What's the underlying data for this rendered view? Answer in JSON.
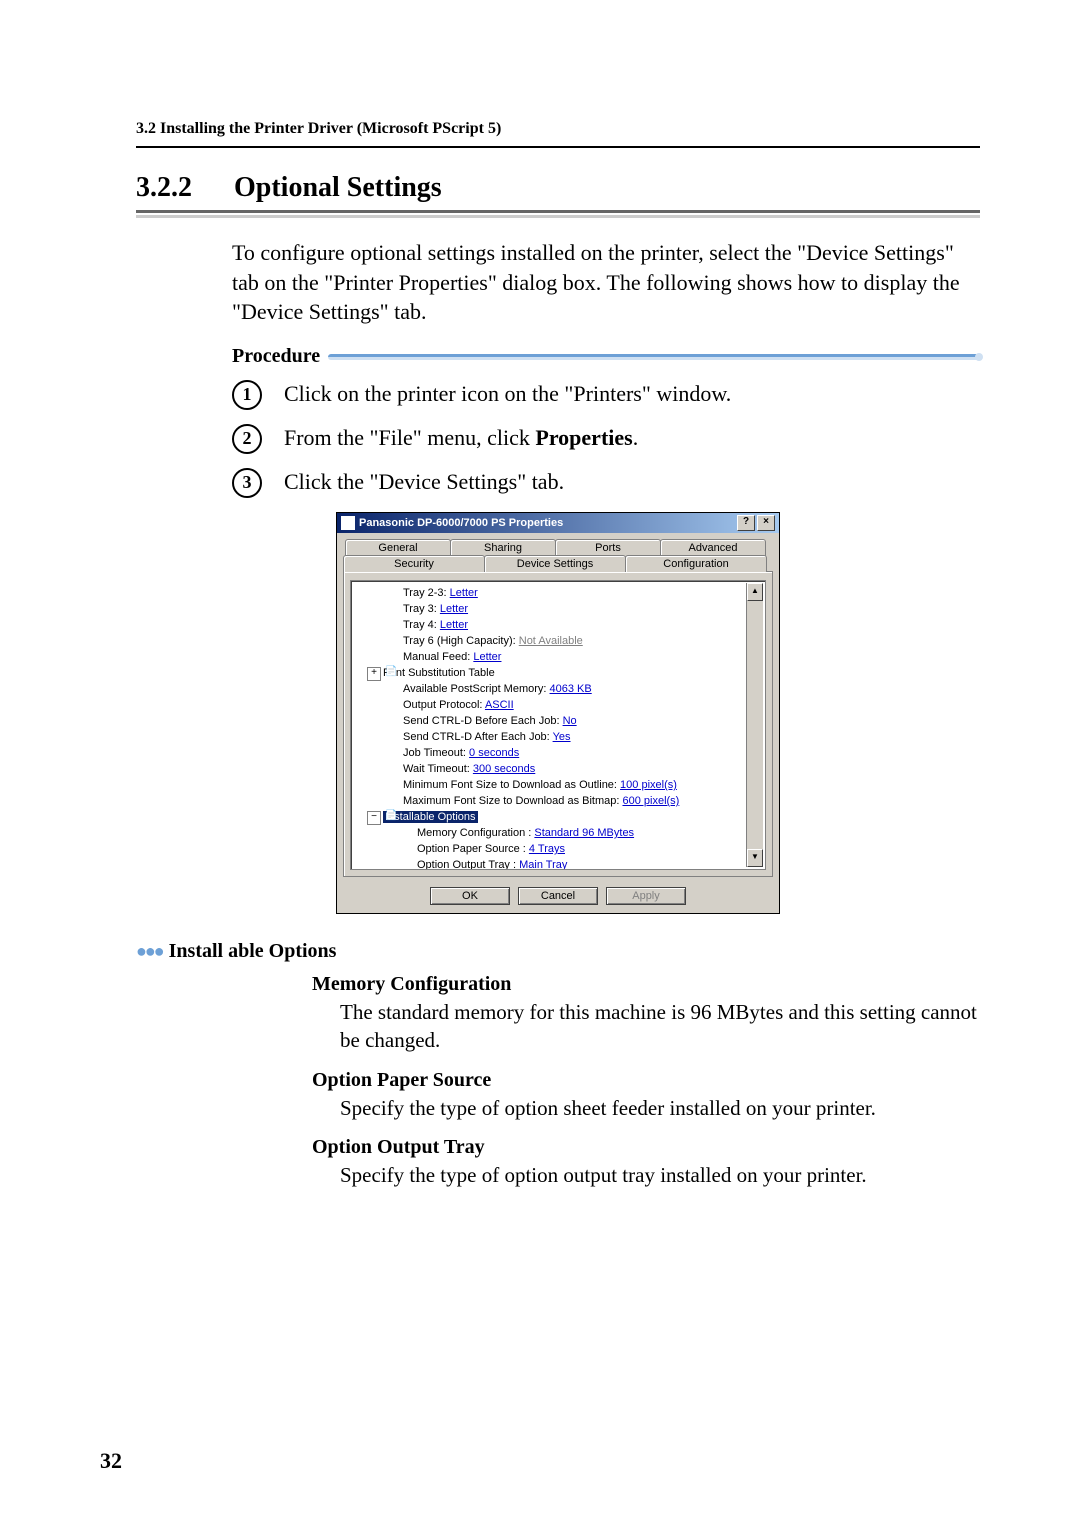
{
  "header": {
    "running": "3.2    Installing the Printer Driver (Microsoft PScript 5)"
  },
  "section": {
    "number": "3.2.2",
    "title": "Optional Settings",
    "intro": "To configure optional settings installed on the printer, select the \"Device Settings\" tab on the \"Printer Properties\" dialog box. The following shows how to display the \"Device Settings\" tab."
  },
  "procedure": {
    "heading": "Procedure",
    "steps": [
      {
        "num": "1",
        "text_pre": "Click on the printer icon on the \"Printers\" window.",
        "bold": "",
        "text_post": ""
      },
      {
        "num": "2",
        "text_pre": "From the \"File\" menu, click ",
        "bold": "Properties",
        "text_post": "."
      },
      {
        "num": "3",
        "text_pre": "Click the  \"Device Settings\" tab.",
        "bold": "",
        "text_post": ""
      }
    ]
  },
  "dialog": {
    "title": "Panasonic DP-6000/7000 PS Properties",
    "help": "?",
    "close": "×",
    "tabs_back": [
      "General",
      "Sharing",
      "Ports",
      "Advanced"
    ],
    "tabs_front": [
      "Security",
      "Device Settings",
      "Configuration"
    ],
    "tree": [
      {
        "lvl": "1",
        "label": "Tray 2-3: ",
        "link": "Letter"
      },
      {
        "lvl": "1",
        "label": "Tray 3: ",
        "link": "Letter"
      },
      {
        "lvl": "1",
        "label": "Tray 4: ",
        "link": "Letter"
      },
      {
        "lvl": "1",
        "label": "Tray 6 (High Capacity): ",
        "gray": "Not Available"
      },
      {
        "lvl": "1",
        "label": "Manual Feed: ",
        "link": "Letter"
      },
      {
        "lvl": "0",
        "icon": "plus",
        "label": "Font Substitution Table"
      },
      {
        "lvl": "0b",
        "label": "Available PostScript Memory: ",
        "link": "4063 KB"
      },
      {
        "lvl": "0b",
        "label": "Output Protocol: ",
        "link": "ASCII"
      },
      {
        "lvl": "0b",
        "label": "Send CTRL-D Before Each Job: ",
        "link": "No"
      },
      {
        "lvl": "0b",
        "label": "Send CTRL-D After Each Job: ",
        "link": "Yes"
      },
      {
        "lvl": "0b",
        "label": "Job Timeout: ",
        "link": "0 seconds"
      },
      {
        "lvl": "0b",
        "label": "Wait Timeout: ",
        "link": "300 seconds"
      },
      {
        "lvl": "0b",
        "label": "Minimum Font Size to Download as Outline: ",
        "link": "100 pixel(s)"
      },
      {
        "lvl": "0b",
        "label": "Maximum Font Size to Download as Bitmap: ",
        "link": "600 pixel(s)"
      },
      {
        "lvl": "0",
        "icon": "minus",
        "sel": true,
        "chip": "Installable Options"
      },
      {
        "lvl": "1b",
        "label": "Memory Configuration : ",
        "link": "Standard 96 MBytes"
      },
      {
        "lvl": "1b",
        "label": "Option Paper Source : ",
        "link": "4 Trays"
      },
      {
        "lvl": "1b",
        "label": "Option Output Tray : ",
        "link": "Main Tray"
      }
    ],
    "scroll_up": "▲",
    "scroll_down": "▼",
    "buttons": {
      "ok": "OK",
      "cancel": "Cancel",
      "apply": "Apply"
    }
  },
  "install": {
    "heading": "Install able Options",
    "items": [
      {
        "title": "Memory Configuration",
        "body": "The standard memory for this machine is 96 MBytes and this setting cannot be changed."
      },
      {
        "title": "Option Paper Source",
        "body": "Specify the type of option sheet feeder installed on your printer."
      },
      {
        "title": "Option Output Tray",
        "body": "Specify the type of option output tray installed on your printer."
      }
    ]
  },
  "page_number": "32"
}
